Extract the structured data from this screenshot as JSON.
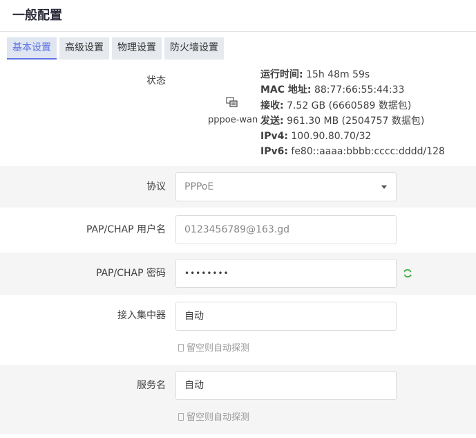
{
  "page": {
    "title": "一般配置"
  },
  "tabs": [
    {
      "label": "基本设置",
      "active": true
    },
    {
      "label": "高级设置",
      "active": false
    },
    {
      "label": "物理设置",
      "active": false
    },
    {
      "label": "防火墙设置",
      "active": false
    }
  ],
  "status": {
    "label": "状态",
    "icon": "network-interface-icon",
    "ifname": "pppoe-wan",
    "uptime_label": "运行时间:",
    "uptime": "15h 48m 59s",
    "mac_label": "MAC 地址:",
    "mac": "88:77:66:55:44:33",
    "rx_label": "接收:",
    "rx": "7.52 GB (6660589 数据包)",
    "tx_label": "发送:",
    "tx": "961.30 MB (2504757 数据包)",
    "ipv4_label": "IPv4:",
    "ipv4": "100.90.80.70/32",
    "ipv6_label": "IPv6:",
    "ipv6": "fe80::aaaa:bbbb:cccc:dddd/128"
  },
  "protocol": {
    "label": "协议",
    "value": "PPPoE"
  },
  "username": {
    "label": "PAP/CHAP 用户名",
    "value": "0123456789@163.gd"
  },
  "password": {
    "label": "PAP/CHAP 密码",
    "value": "••••••••"
  },
  "concentrator": {
    "label": "接入集中器",
    "value": "自动",
    "hint": "留空则自动探测"
  },
  "service": {
    "label": "服务名",
    "value": "自动",
    "hint": "留空则自动探测"
  },
  "colors": {
    "accent": "#5e72e4",
    "reveal_icon": "#3cb043",
    "row_shade": "#f5f5f5"
  }
}
